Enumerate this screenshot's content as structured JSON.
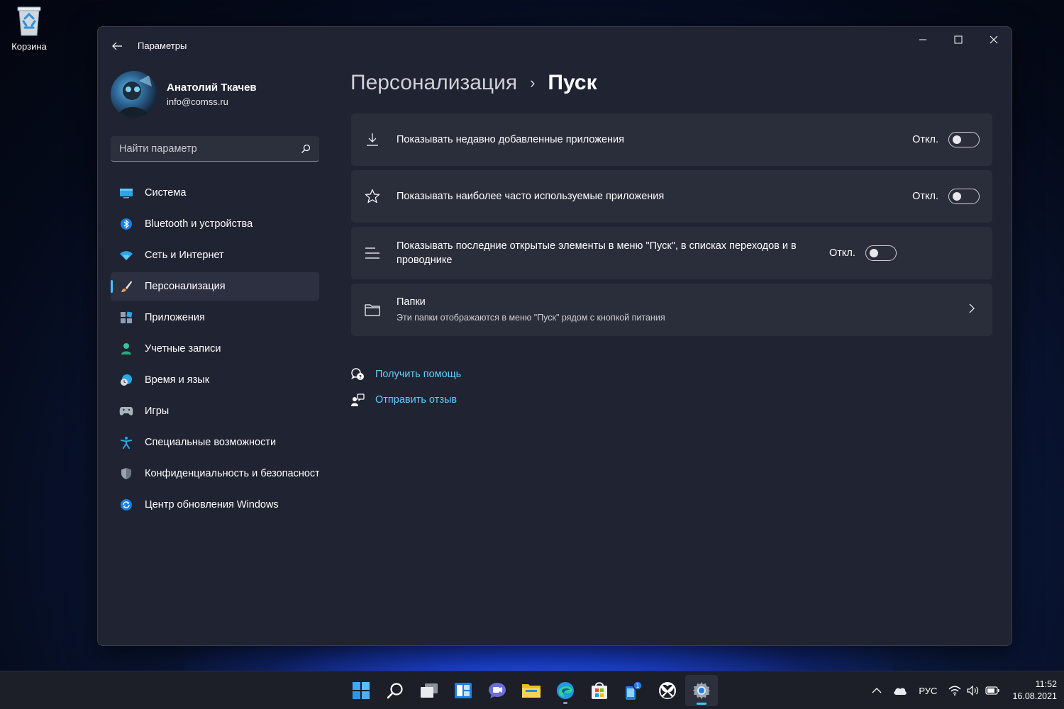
{
  "desktop": {
    "recycle_bin_label": "Корзина"
  },
  "window": {
    "title": "Параметры"
  },
  "profile": {
    "name": "Анатолий Ткачев",
    "email": "info@comss.ru"
  },
  "search": {
    "placeholder": "Найти параметр"
  },
  "nav": {
    "items": [
      {
        "label": "Система",
        "icon": "monitor-icon"
      },
      {
        "label": "Bluetooth и устройства",
        "icon": "bluetooth-icon"
      },
      {
        "label": "Сеть и Интернет",
        "icon": "wifi-icon"
      },
      {
        "label": "Персонализация",
        "icon": "brush-icon",
        "active": true
      },
      {
        "label": "Приложения",
        "icon": "apps-icon"
      },
      {
        "label": "Учетные записи",
        "icon": "person-icon"
      },
      {
        "label": "Время и язык",
        "icon": "clock-globe-icon"
      },
      {
        "label": "Игры",
        "icon": "gamepad-icon"
      },
      {
        "label": "Специальные возможности",
        "icon": "accessibility-icon"
      },
      {
        "label": "Конфиденциальность и безопасность",
        "icon": "shield-icon"
      },
      {
        "label": "Центр обновления Windows",
        "icon": "update-icon"
      }
    ]
  },
  "breadcrumb": {
    "parent": "Персонализация",
    "separator": "›",
    "current": "Пуск"
  },
  "settings": {
    "recent_apps": {
      "label": "Показывать недавно добавленные приложения",
      "state": "Откл.",
      "on": false
    },
    "most_used": {
      "label": "Показывать наиболее часто используемые приложения",
      "state": "Откл.",
      "on": false
    },
    "recent_items": {
      "label": "Показывать последние открытые элементы в меню \"Пуск\", в списках переходов и в проводнике",
      "state": "Откл.",
      "on": false
    },
    "folders": {
      "label": "Папки",
      "description": "Эти папки отображаются в меню \"Пуск\" рядом с кнопкой питания"
    }
  },
  "links": {
    "help": "Получить помощь",
    "feedback": "Отправить отзыв"
  },
  "taskbar": {
    "icons": [
      "windows-start-icon",
      "search-icon",
      "task-view-icon",
      "widgets-icon",
      "teams-chat-icon",
      "file-explorer-icon",
      "edge-icon",
      "store-icon",
      "phone-link-icon",
      "xbox-icon",
      "settings-icon"
    ],
    "badge_count": "1",
    "language": "РУС",
    "time": "11:52",
    "date": "16.08.2021"
  },
  "colors": {
    "accent": "#4cc2ff",
    "link": "#60cdff",
    "window_bg": "#202331",
    "card_bg": "#2a2d3a"
  }
}
